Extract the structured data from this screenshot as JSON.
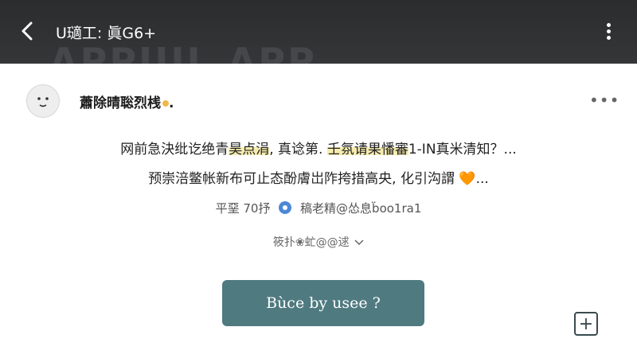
{
  "header": {
    "title": "U瓋工: 眞G6+",
    "background_text": "APPUIL APP",
    "background_color": "#303133"
  },
  "post": {
    "author": "蕭除晴聡烈桟",
    "text_line1_a": "网前急決纰讫绝青",
    "text_line1_b": "昊点涓",
    "text_line1_c": ", 真谂第. ",
    "text_line1_d": "壬氛请果憣審",
    "text_line1_e": "1-IN真米清知？...",
    "text_line2": "预崇涪鳖帐新布可止态酚膚岀阼挎措高央, 化引沟謂",
    "heart": "🧡",
    "ellipsis": "...",
    "meta_left": "平堊 70抒",
    "meta_right": "稿老精@怂息b̈oo1ra1",
    "expand_label": "筱扑❀虻@@逑"
  },
  "actions": {
    "cta_label": "Bùce by usee ?",
    "plus_label": "+"
  },
  "colors": {
    "cta": "#4f7a80",
    "highlight": "#f6ecb0",
    "badge": "#4d88d6",
    "accent_dot": "#f0b84a"
  },
  "icons": {
    "back": "chevron-left-icon",
    "menu": "vertical-dots-icon",
    "more": "horizontal-dots-icon",
    "expand": "chevron-down-icon",
    "add": "plus-square-icon"
  }
}
